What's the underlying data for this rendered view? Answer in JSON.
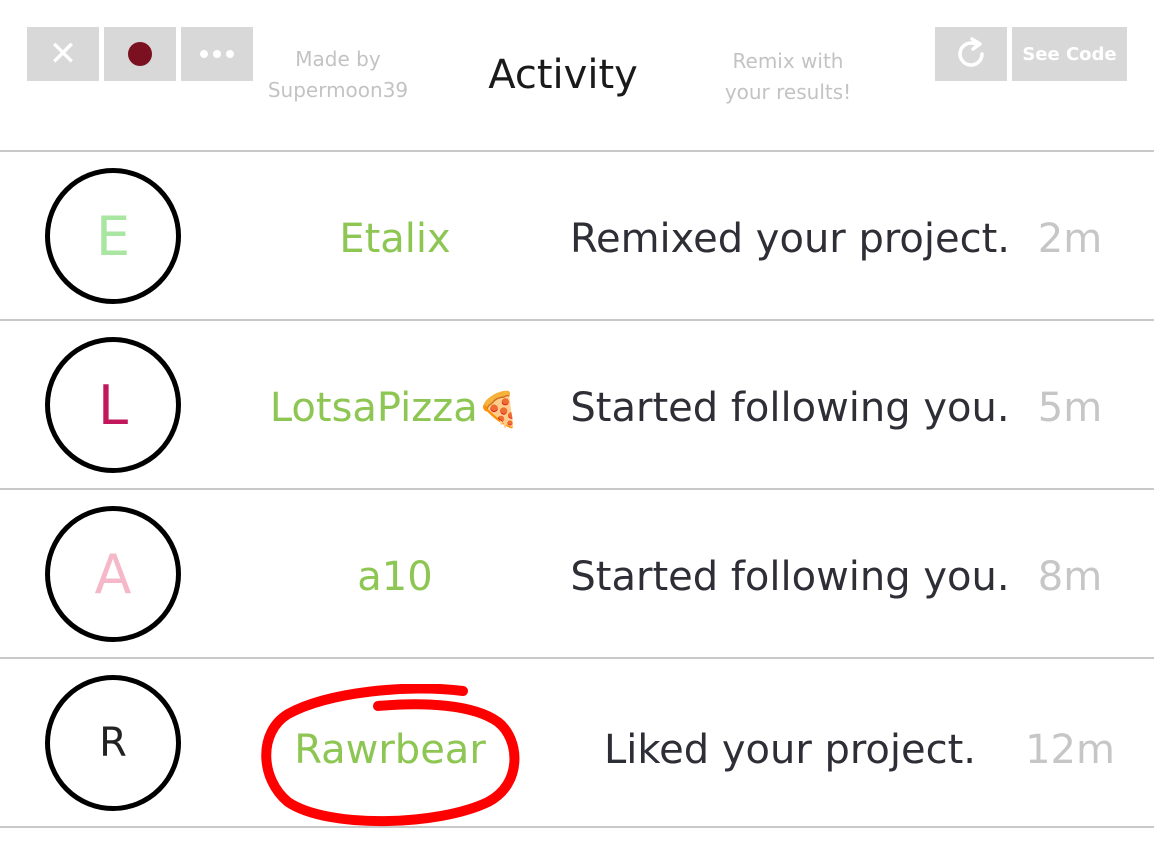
{
  "toolbar": {
    "close_icon": "close-icon",
    "record_icon": "record-icon",
    "more_icon": "more-icon",
    "refresh_icon": "refresh-icon",
    "see_code_label": "See Code",
    "made_by_line1": "Made by",
    "made_by_line2": "Supermoon39",
    "remix_line1": "Remix with",
    "remix_line2": "your results!"
  },
  "header": {
    "title": "Activity"
  },
  "colors": {
    "username": "#8dc653",
    "record": "#7a1020",
    "highlight": "#ff0000"
  },
  "activity": [
    {
      "initial": "E",
      "initial_color": "#a8e6a2",
      "username": "Etalix",
      "action": "Remixed your project.",
      "time": "2m"
    },
    {
      "initial": "L",
      "initial_color": "#c2185b",
      "username": "LotsaPizza",
      "username_icon": "🍕",
      "action": "Started following you.",
      "time": "5m"
    },
    {
      "initial": "A",
      "initial_color": "#f5b8c9",
      "username": "a10",
      "action": "Started following you.",
      "time": "8m"
    },
    {
      "initial": "R",
      "initial_color": "#222222",
      "username": "Rawrbear",
      "action": "Liked your project.",
      "time": "12m",
      "highlighted": true
    }
  ]
}
